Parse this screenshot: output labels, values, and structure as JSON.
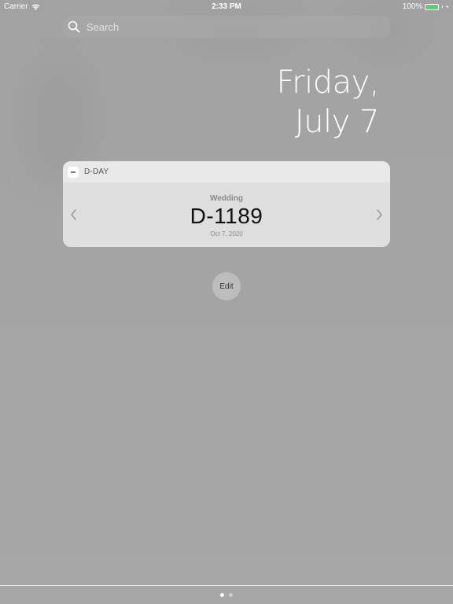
{
  "status_bar": {
    "carrier": "Carrier",
    "time": "2:33 PM",
    "battery": "100%",
    "battery_level": 1.0,
    "battery_color": "#4cd964"
  },
  "search": {
    "placeholder": "Search",
    "icon": "search-icon"
  },
  "date": {
    "line1": "Friday,",
    "line2": "July 7"
  },
  "widget": {
    "title": "D-DAY",
    "event_name": "Wedding",
    "dday": "D-1189",
    "event_date": "Oct 7, 2020",
    "prev_icon": "chevron-left-icon",
    "next_icon": "chevron-right-icon"
  },
  "edit": {
    "label": "Edit"
  },
  "pages": {
    "count": 2,
    "current": 1
  }
}
